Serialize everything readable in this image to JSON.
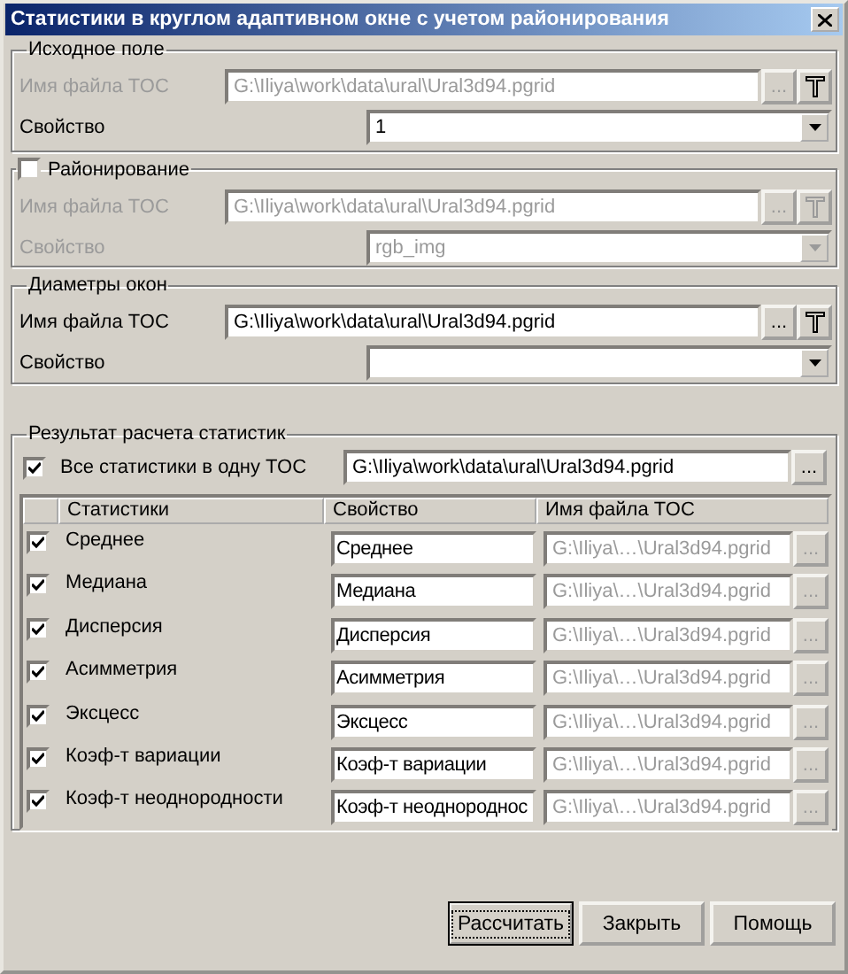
{
  "window": {
    "title": "Статистики в круглом адаптивном окне с учетом районирования"
  },
  "source_field": {
    "title": "Исходное поле",
    "file_label": "Имя файла TOC",
    "file_path": "G:\\Iliya\\work\\data\\ural\\Ural3d94.pgrid",
    "browse": "...",
    "property_label": "Свойство",
    "property_value": "1"
  },
  "zoning": {
    "title": "Районирование",
    "checked": false,
    "file_label": "Имя файла TOC",
    "file_path": "G:\\Iliya\\work\\data\\ural\\Ural3d94.pgrid",
    "browse": "...",
    "property_label": "Свойство",
    "property_value": "rgb_img"
  },
  "window_diameters": {
    "title": "Диаметры окон",
    "file_label": "Имя файла TOC",
    "file_path": "G:\\Iliya\\work\\data\\ural\\Ural3d94.pgrid",
    "browse": "...",
    "property_label": "Свойство"
  },
  "results": {
    "title": "Результат расчета статистик",
    "all_in_one": {
      "label": "Все статистики в одну TOC",
      "checked": true,
      "path": "G:\\Iliya\\work\\data\\ural\\Ural3d94.pgrid",
      "browse": "..."
    },
    "columns": [
      "Статистики",
      "Свойство",
      "Имя файла TOC"
    ],
    "rows": [
      {
        "name": "Среднее",
        "checked": true,
        "property": "Среднее",
        "path": "G:\\Iliya\\…\\Ural3d94.pgrid",
        "browse": "..."
      },
      {
        "name": "Медиана",
        "checked": true,
        "property": "Медиана",
        "path": "G:\\Iliya\\…\\Ural3d94.pgrid",
        "browse": "..."
      },
      {
        "name": "Дисперсия",
        "checked": true,
        "property": "Дисперсия",
        "path": "G:\\Iliya\\…\\Ural3d94.pgrid",
        "browse": "..."
      },
      {
        "name": "Асимметрия",
        "checked": true,
        "property": "Асимметрия",
        "path": "G:\\Iliya\\…\\Ural3d94.pgrid",
        "browse": "..."
      },
      {
        "name": "Эксцесс",
        "checked": true,
        "property": "Эксцесс",
        "path": "G:\\Iliya\\…\\Ural3d94.pgrid",
        "browse": "..."
      },
      {
        "name": "Коэф-т вариации",
        "checked": true,
        "property": "Коэф-т вариации",
        "path": "G:\\Iliya\\…\\Ural3d94.pgrid",
        "browse": "..."
      },
      {
        "name": "Коэф-т неоднородности",
        "checked": true,
        "property": "Коэф-т неоднороднос",
        "path": "G:\\Iliya\\…\\Ural3d94.pgrid",
        "browse": "..."
      }
    ]
  },
  "buttons": [
    {
      "label": "Рассчитать",
      "default": true
    },
    {
      "label": "Закрыть",
      "default": false
    },
    {
      "label": "Помощь",
      "default": false
    }
  ]
}
